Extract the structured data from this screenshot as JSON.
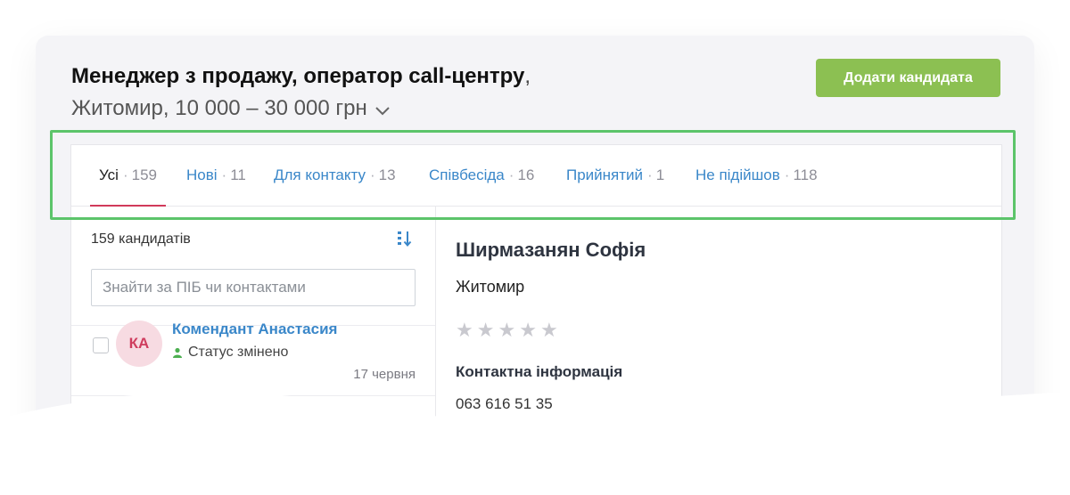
{
  "vacancy": {
    "title": "Менеджер з продажу, оператор call-центру",
    "comma": ",",
    "subtitle": "Житомир, 10 000 – 30 000 грн"
  },
  "add_candidate_label": "Додати кандидата",
  "tabs": [
    {
      "label": "Усі",
      "count": "159",
      "active": true
    },
    {
      "label": "Нові",
      "count": "11",
      "active": false
    },
    {
      "label": "Для контакту",
      "count": "13",
      "active": false
    },
    {
      "label": "Співбесіда",
      "count": "16",
      "active": false
    },
    {
      "label": "Прийнятий",
      "count": "1",
      "active": false
    },
    {
      "label": "Не підійшов",
      "count": "118",
      "active": false
    }
  ],
  "tab_separator": "·",
  "candidates_count": "159 кандидатів",
  "search": {
    "placeholder": "Знайти за ПІБ чи контактами",
    "value": ""
  },
  "candidates": [
    {
      "initials": "КА",
      "name": "Комендант Анастасия",
      "status": "Статус змінено",
      "date": "17 червня"
    }
  ],
  "detail": {
    "name": "Ширмазанян Софія",
    "city": "Житомир",
    "rating": 0,
    "rating_max": 5,
    "contact_title": "Контактна інформація",
    "phone": "063 616 51 35"
  },
  "colors": {
    "accent_green": "#8cc052",
    "link_blue": "#3a87c9",
    "active_tab_underline": "#d13a5a",
    "highlight_border": "#5cc46a",
    "avatar_bg": "#f7dbe2",
    "avatar_text": "#cf3d5e"
  },
  "icons": {
    "subtitle_toggle": "chevron-down-icon",
    "sort": "sort-icon",
    "status": "person-icon",
    "rating": "star-icon"
  }
}
